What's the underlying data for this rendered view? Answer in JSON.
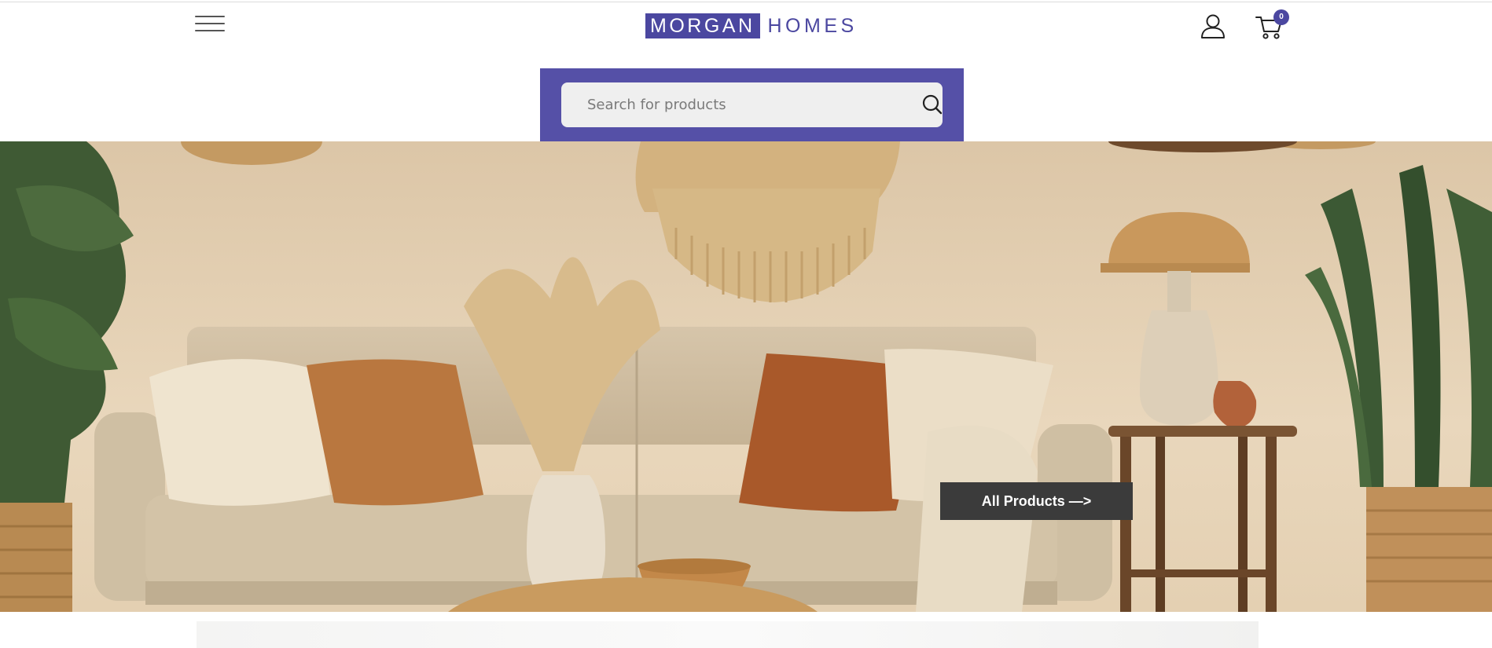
{
  "header": {
    "logo_primary": "MORGAN",
    "logo_secondary": "HOMES",
    "cart_count": "0",
    "icons": {
      "menu": "hamburger-icon",
      "account": "user-icon",
      "cart": "cart-icon"
    }
  },
  "search": {
    "placeholder": "Search for products",
    "value": "",
    "icon": "search-icon"
  },
  "hero": {
    "cta_label": "All Products —>",
    "image": "living-room-boho-sofa"
  },
  "colors": {
    "brand": "#4b47a0",
    "search_band": "#5550a7",
    "cta_background": "#3b3b3b"
  }
}
